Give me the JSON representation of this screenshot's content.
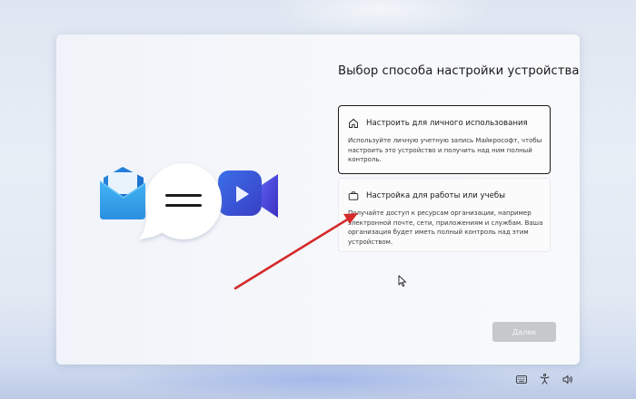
{
  "title": "Выбор способа настройки устройства",
  "options": [
    {
      "icon": "home-icon",
      "title": "Настроить для личного использования",
      "desc_lines": [
        "Используйте личную учетную запись Майкрософт, чтобы",
        "настроить это устройство и получить над ним полный",
        "контроль."
      ],
      "selected": true
    },
    {
      "icon": "briefcase-icon",
      "title": "Настройка для работы или учебы",
      "desc_lines": [
        "Получайте доступ к ресурсам организации, например",
        "электронной почте, сети, приложениям и службам. Ваша",
        "организация будет иметь полный контроль над этим",
        "устройством."
      ],
      "selected": false
    }
  ],
  "next_label": "Далее",
  "next_enabled": false,
  "tray_icons": [
    "keyboard-icon",
    "accessibility-icon",
    "volume-icon"
  ],
  "annotation_color": "#d42a2a"
}
